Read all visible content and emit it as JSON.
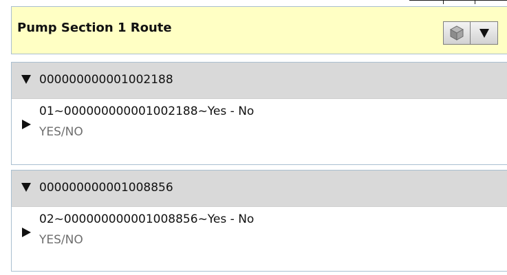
{
  "route": {
    "title": "Pump Section 1 Route",
    "icons": {
      "cube": "cube-icon",
      "dropdown": "chevron-down-icon"
    }
  },
  "assets": [
    {
      "id": "000000000001002188",
      "checks": [
        {
          "title": "01~000000000001002188~Yes - No",
          "subtitle": "YES/NO"
        }
      ]
    },
    {
      "id": "000000000001008856",
      "checks": [
        {
          "title": "02~000000000001008856~Yes - No",
          "subtitle": "YES/NO"
        }
      ]
    }
  ],
  "colors": {
    "header_bg": "#ffffc4",
    "panel_border": "#a9bfd0",
    "asset_header_bg": "#d9d9d9",
    "subtitle_text": "#6e6e6e"
  }
}
